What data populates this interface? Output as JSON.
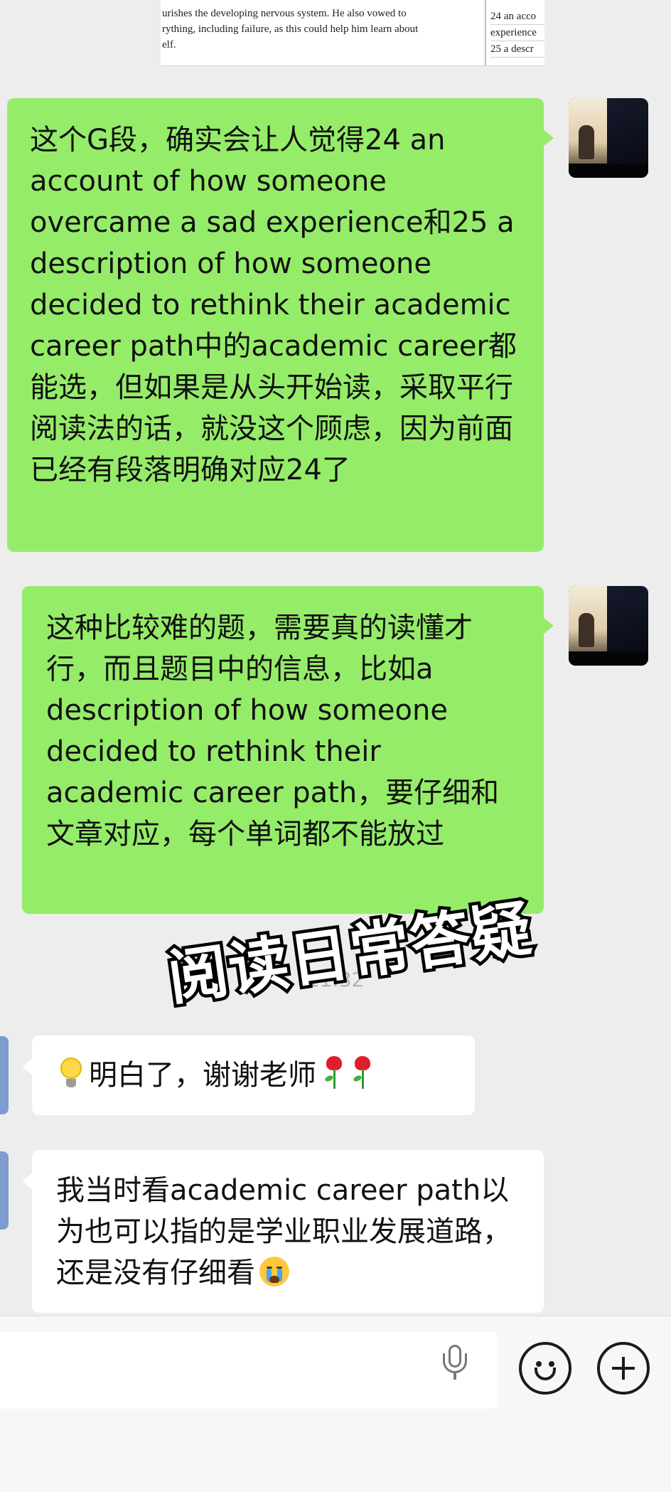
{
  "snippet": {
    "left_lines": [
      "urishes the developing nervous system. He also vowed to",
      "rything, including failure, as this could help him learn about",
      "elf."
    ],
    "right_lines": [
      "24 an acco",
      "experience",
      "25 a descr"
    ]
  },
  "messages": [
    {
      "side": "right",
      "text": "这个G段，确实会让人觉得24 an account of how someone overcame a sad experience和25 a description of how someone decided to rethink their academic career path中的academic career都能选，但如果是从头开始读，采取平行阅读法的话，就没这个顾虑，因为前面已经有段落明确对应24了"
    },
    {
      "side": "right",
      "text": "这种比较难的题，需要真的读懂才行，而且题目中的信息，比如a description of how someone decided to rethink their academic career path，要仔细和文章对应，每个单词都不能放过"
    },
    {
      "side": "left",
      "text": "明白了，谢谢老师",
      "leading_emoji": "light-bulb-icon",
      "trailing_emoji": [
        "rose-icon",
        "rose-icon"
      ]
    },
    {
      "side": "left",
      "text": "我当时看academic career path以为也可以指的是学业职业发展道路，还是没有仔细看",
      "trailing_emoji": "crying-face-icon"
    }
  ],
  "timestamp": "11:32",
  "watermark": "阅读日常答疑",
  "input_bar": {
    "mic_icon": "microphone-icon",
    "emoji_icon": "smiley-icon",
    "plus_icon": "plus-circle-icon"
  },
  "colors": {
    "background": "#ededed",
    "outgoing_bubble": "#95ec69",
    "incoming_bubble": "#ffffff"
  }
}
